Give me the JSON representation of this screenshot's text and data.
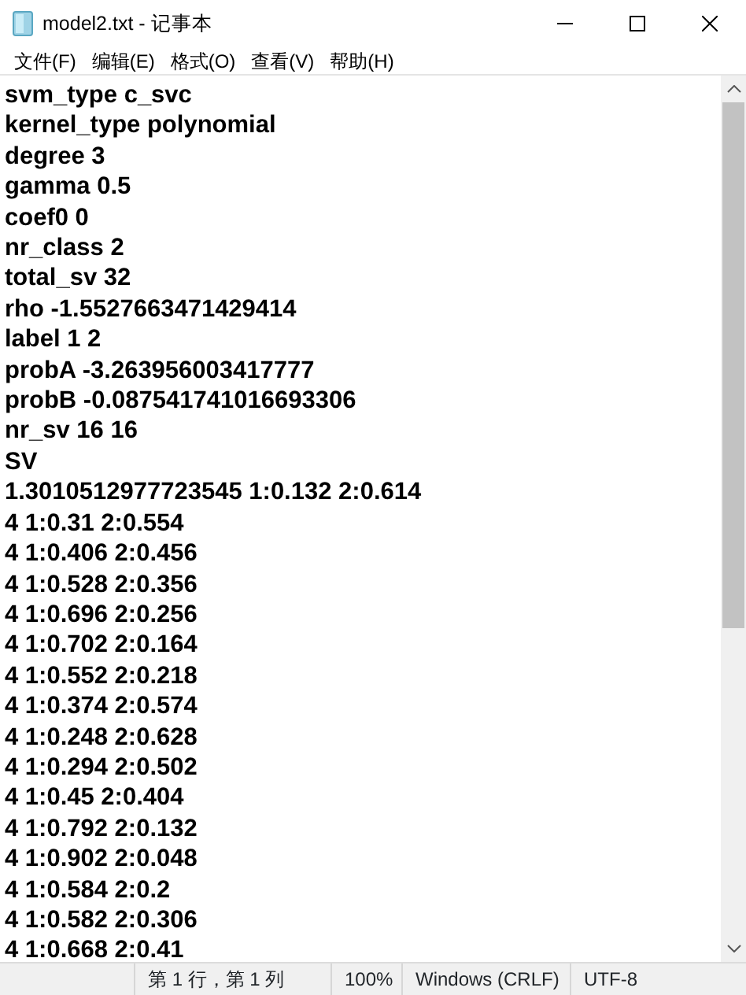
{
  "window": {
    "title": "model2.txt - 记事本"
  },
  "menu": [
    "文件(F)",
    "编辑(E)",
    "格式(O)",
    "查看(V)",
    "帮助(H)"
  ],
  "lines": [
    "svm_type c_svc",
    "kernel_type polynomial",
    "degree 3",
    "gamma 0.5",
    "coef0 0",
    "nr_class 2",
    "total_sv 32",
    "rho -1.5527663471429414",
    "label 1 2",
    "probA -3.263956003417777",
    "probB -0.087541741016693306",
    "nr_sv 16 16",
    "SV",
    "1.3010512977723545 1:0.132 2:0.614",
    "4 1:0.31 2:0.554",
    "4 1:0.406 2:0.456",
    "4 1:0.528 2:0.356",
    "4 1:0.696 2:0.256",
    "4 1:0.702 2:0.164",
    "4 1:0.552 2:0.218",
    "4 1:0.374 2:0.574",
    "4 1:0.248 2:0.628",
    "4 1:0.294 2:0.502",
    "4 1:0.45 2:0.404",
    "4 1:0.792 2:0.132",
    "4 1:0.902 2:0.048",
    "4 1:0.584 2:0.2",
    "4 1:0.582 2:0.306",
    "4 1:0.668 2:0.41"
  ],
  "status_bar": {
    "position": "第 1 行，第 1 列",
    "zoom": "100%",
    "line_ending": "Windows (CRLF)",
    "encoding": "UTF-8"
  }
}
